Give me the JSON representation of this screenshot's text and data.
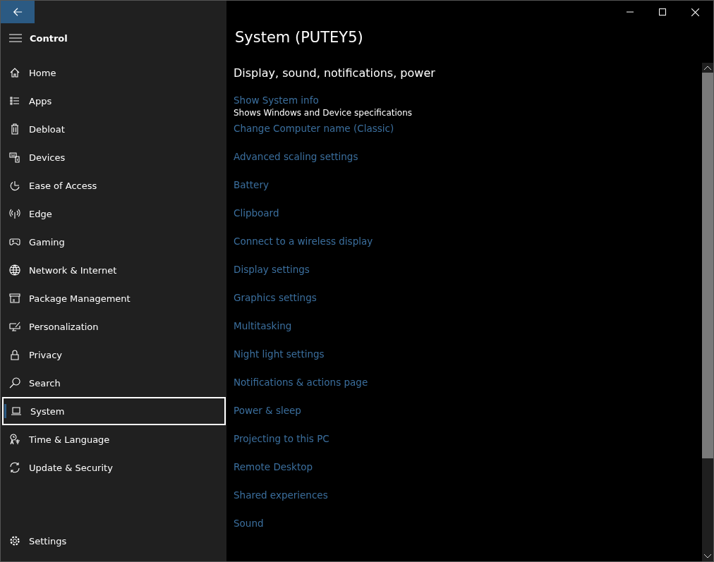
{
  "sidebar": {
    "title": "Control",
    "items": [
      {
        "label": "Home",
        "selected": false
      },
      {
        "label": "Apps",
        "selected": false
      },
      {
        "label": "Debloat",
        "selected": false
      },
      {
        "label": "Devices",
        "selected": false
      },
      {
        "label": "Ease of Access",
        "selected": false
      },
      {
        "label": "Edge",
        "selected": false
      },
      {
        "label": "Gaming",
        "selected": false
      },
      {
        "label": "Network & Internet",
        "selected": false
      },
      {
        "label": "Package Management",
        "selected": false
      },
      {
        "label": "Personalization",
        "selected": false
      },
      {
        "label": "Privacy",
        "selected": false
      },
      {
        "label": "Search",
        "selected": false
      },
      {
        "label": "System",
        "selected": true
      },
      {
        "label": "Time & Language",
        "selected": false
      },
      {
        "label": "Update & Security",
        "selected": false
      }
    ],
    "footer": "Settings"
  },
  "page": {
    "title": "System (PUTEY5)",
    "section": "Display, sound, notifications, power",
    "links": [
      {
        "label": "Show System info",
        "description": "Shows Windows and Device specifications"
      },
      {
        "label": "Change Computer name (Classic)"
      },
      {
        "label": "Advanced scaling settings"
      },
      {
        "label": "Battery"
      },
      {
        "label": "Clipboard"
      },
      {
        "label": "Connect to a wireless display"
      },
      {
        "label": "Display settings"
      },
      {
        "label": "Graphics settings"
      },
      {
        "label": "Multitasking"
      },
      {
        "label": "Night light settings"
      },
      {
        "label": "Notifications & actions page"
      },
      {
        "label": "Power & sleep"
      },
      {
        "label": "Projecting to this PC"
      },
      {
        "label": "Remote Desktop"
      },
      {
        "label": "Shared experiences"
      },
      {
        "label": "Sound"
      }
    ]
  }
}
